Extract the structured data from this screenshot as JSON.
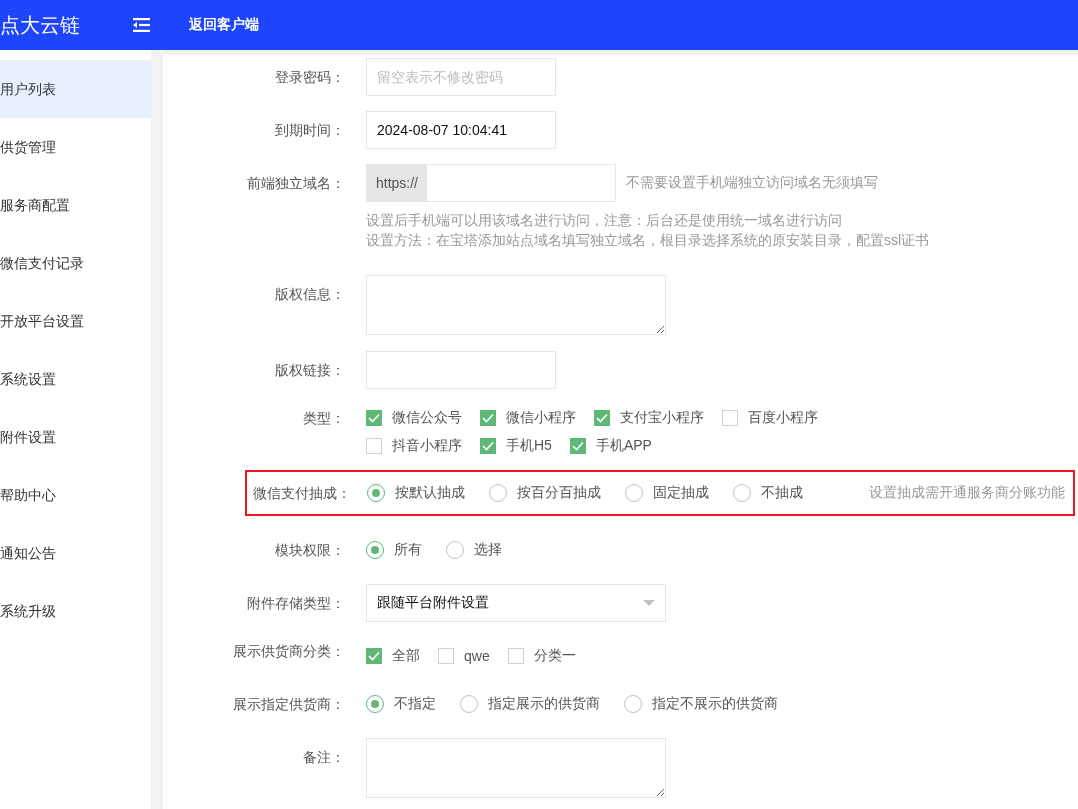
{
  "header": {
    "logo": "点大云链",
    "back_link": "返回客户端"
  },
  "sidebar": {
    "items": [
      {
        "label": "用户列表",
        "selected": true
      },
      {
        "label": "供货管理",
        "selected": false
      },
      {
        "label": "服务商配置",
        "selected": false
      },
      {
        "label": "微信支付记录",
        "selected": false
      },
      {
        "label": "开放平台设置",
        "selected": false
      },
      {
        "label": "系统设置",
        "selected": false
      },
      {
        "label": "附件设置",
        "selected": false
      },
      {
        "label": "帮助中心",
        "selected": false
      },
      {
        "label": "通知公告",
        "selected": false
      },
      {
        "label": "系统升级",
        "selected": false
      }
    ]
  },
  "form": {
    "fields": [
      {
        "kind": "input",
        "label": "登录密码：",
        "placeholder": "留空表示不修改密码"
      },
      {
        "kind": "input",
        "label": "到期时间：",
        "value": "2024-08-07 10:04:41"
      },
      {
        "kind": "prefixed",
        "label": "前端独立域名：",
        "prefix": "https://",
        "aside": "不需要设置手机端独立访问域名无须填写",
        "hints": [
          "设置后手机端可以用该域名进行访问，注意：后台还是使用统一域名进行访问",
          "设置方法：在宝塔添加站点域名填写独立域名，根目录选择系统的原安装目录，配置ssl证书"
        ]
      },
      {
        "kind": "textarea",
        "label": "版权信息："
      },
      {
        "kind": "input",
        "label": "版权链接："
      },
      {
        "kind": "checkboxes",
        "label": "类型：",
        "options": [
          {
            "label": "微信公众号",
            "checked": true
          },
          {
            "label": "微信小程序",
            "checked": true
          },
          {
            "label": "支付宝小程序",
            "checked": true
          },
          {
            "label": "百度小程序",
            "checked": false
          },
          {
            "label": "抖音小程序",
            "checked": false
          },
          {
            "label": "手机H5",
            "checked": true
          },
          {
            "label": "手机APP",
            "checked": true
          }
        ]
      },
      {
        "kind": "radios",
        "label": "微信支付抽成：",
        "highlighted": true,
        "aside": "设置抽成需开通服务商分账功能",
        "options": [
          {
            "label": "按默认抽成",
            "selected": true
          },
          {
            "label": "按百分百抽成",
            "selected": false
          },
          {
            "label": "固定抽成",
            "selected": false
          },
          {
            "label": "不抽成",
            "selected": false
          }
        ]
      },
      {
        "kind": "radios",
        "label": "模块权限：",
        "highlighted": false,
        "options": [
          {
            "label": "所有",
            "selected": true
          },
          {
            "label": "选择",
            "selected": false
          }
        ]
      },
      {
        "kind": "select",
        "label": "附件存储类型：",
        "value": "跟随平台附件设置"
      },
      {
        "kind": "checkboxes",
        "label": "展示供货商分类：",
        "options": [
          {
            "label": "全部",
            "checked": true
          },
          {
            "label": "qwe",
            "checked": false
          },
          {
            "label": "分类一",
            "checked": false
          }
        ]
      },
      {
        "kind": "radios",
        "label": "展示指定供货商：",
        "highlighted": false,
        "options": [
          {
            "label": "不指定",
            "selected": true
          },
          {
            "label": "指定展示的供货商",
            "selected": false
          },
          {
            "label": "指定不展示的供货商",
            "selected": false
          }
        ]
      },
      {
        "kind": "textarea",
        "label": "备注："
      }
    ]
  }
}
